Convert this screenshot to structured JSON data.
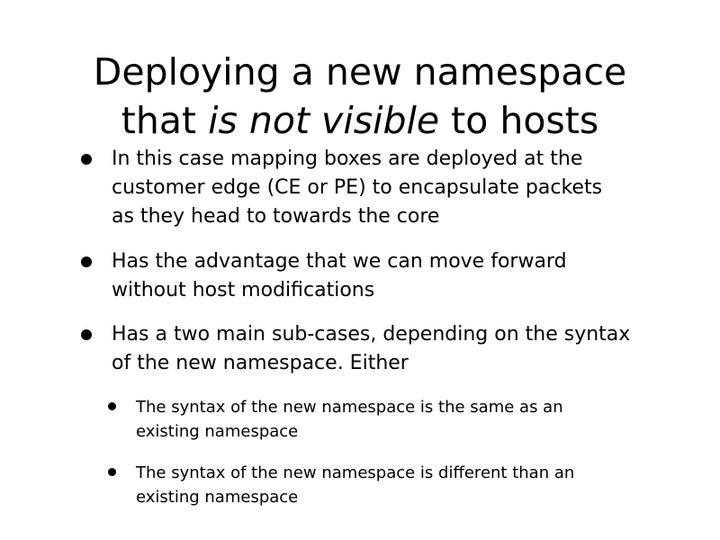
{
  "title": {
    "line1": "Deploying a new namespace",
    "line2_prefix": "that ",
    "line2_emphasis": "is not visible",
    "line2_suffix": " to hosts"
  },
  "bullets": [
    {
      "lines": [
        "In this case mapping boxes are deployed at the",
        "customer edge (CE or PE) to encapsulate packets",
        "as they head to towards the core"
      ]
    },
    {
      "lines": [
        "Has the advantage that we can move forward",
        "without host modifications"
      ]
    },
    {
      "lines": [
        "Has a two main sub-cases, depending on the syntax",
        "of the new namespace. Either"
      ],
      "sub_bullets": [
        {
          "lines": [
            "The syntax of the new namespace is the same as an",
            "existing namespace"
          ]
        },
        {
          "lines": [
            "The syntax of the new namespace is different than an",
            "existing namespace"
          ]
        }
      ]
    }
  ]
}
